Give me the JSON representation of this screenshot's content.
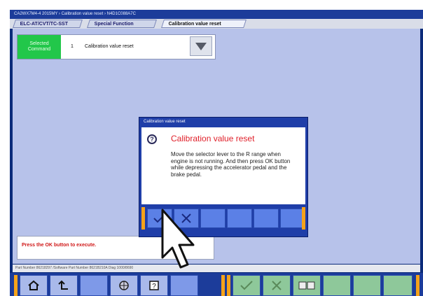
{
  "window": {
    "title": "CA2WX7M4-4 2015MY  ›  Calibration value reset  ›  N4D1C088A7C"
  },
  "tabs": [
    {
      "label": "ELC-AT/CVT/TC-SST"
    },
    {
      "label": "Special Function"
    },
    {
      "label": "Calibration value reset"
    }
  ],
  "command": {
    "selected_label_1": "Selected",
    "selected_label_2": "Command",
    "number": "1",
    "name": "Calibration value reset"
  },
  "dialog": {
    "title": "Calibration value reset",
    "heading": "Calibration value reset",
    "message": "Move the selector lever to the R range when engine is not running. And then press OK button while depressing the accelerator pedal and the brake pedal."
  },
  "message_panel": {
    "text": "Press the OK button to execute."
  },
  "status_bar": {
    "text": "Part Number 86218297 /Software Part Number 8621B210A Diag 1000/8690"
  },
  "colors": {
    "selected_green": "#22c74a",
    "heading_red": "#e0202a",
    "accent_orange": "#f5a21a",
    "frame_blue": "#0b2b7a"
  },
  "icons": [
    "question-icon",
    "check-icon",
    "cross-icon",
    "home-icon",
    "back-icon",
    "globe-icon",
    "help-icon",
    "pointer-cursor-icon",
    "dropdown-arrow-icon",
    "data-list-icon"
  ]
}
